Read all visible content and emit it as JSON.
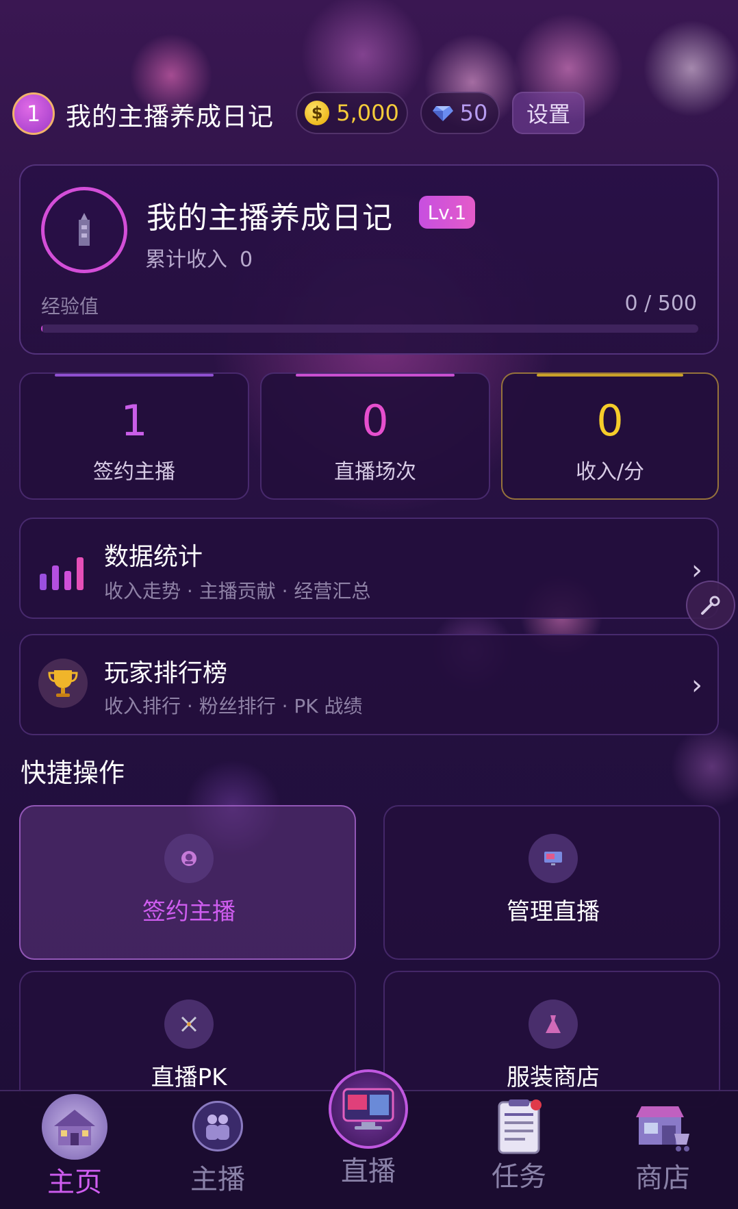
{
  "header": {
    "level": "1",
    "title": "我的主播养成日记",
    "coins": "5,000",
    "coin_symbol": "$",
    "diamonds": "50",
    "settings_label": "设置"
  },
  "profile": {
    "name": "我的主播养成日记",
    "level_tag": "Lv.1",
    "income_label": "累计收入",
    "income_value": "0",
    "exp_label": "经验值",
    "exp_value": "0 / 500",
    "exp_progress": 0.002
  },
  "stats": [
    {
      "value": "1",
      "label": "签约主播",
      "color": "#c95ee8"
    },
    {
      "value": "0",
      "label": "直播场次",
      "color": "#e64fce"
    },
    {
      "value": "0",
      "label": "收入/分",
      "color": "#f5cc2a"
    }
  ],
  "menus": [
    {
      "title": "数据统计",
      "subtitle": "收入走势 · 主播贡献 · 经营汇总",
      "icon": "bar-chart-icon"
    },
    {
      "title": "玩家排行榜",
      "subtitle": "收入排行 · 粉丝排行 · PK 战绩",
      "icon": "trophy-icon"
    }
  ],
  "quick_actions": {
    "title": "快捷操作",
    "items": [
      {
        "label": "签约主播",
        "icon": "sign-icon",
        "active": true
      },
      {
        "label": "管理直播",
        "icon": "monitor-icon",
        "active": false
      },
      {
        "label": "直播PK",
        "icon": "swords-icon",
        "active": false
      },
      {
        "label": "服装商店",
        "icon": "dress-icon",
        "active": false
      }
    ]
  },
  "bottom_nav": [
    {
      "label": "主页",
      "icon": "house-icon",
      "active": true
    },
    {
      "label": "主播",
      "icon": "team-icon",
      "active": false
    },
    {
      "label": "直播",
      "icon": "live-tv-icon",
      "active": false
    },
    {
      "label": "任务",
      "icon": "task-list-icon",
      "active": false
    },
    {
      "label": "商店",
      "icon": "shop-icon",
      "active": false
    }
  ],
  "colors": {
    "accent": "#cf5df0",
    "gold": "#f5cc3a",
    "background": "#241040"
  }
}
